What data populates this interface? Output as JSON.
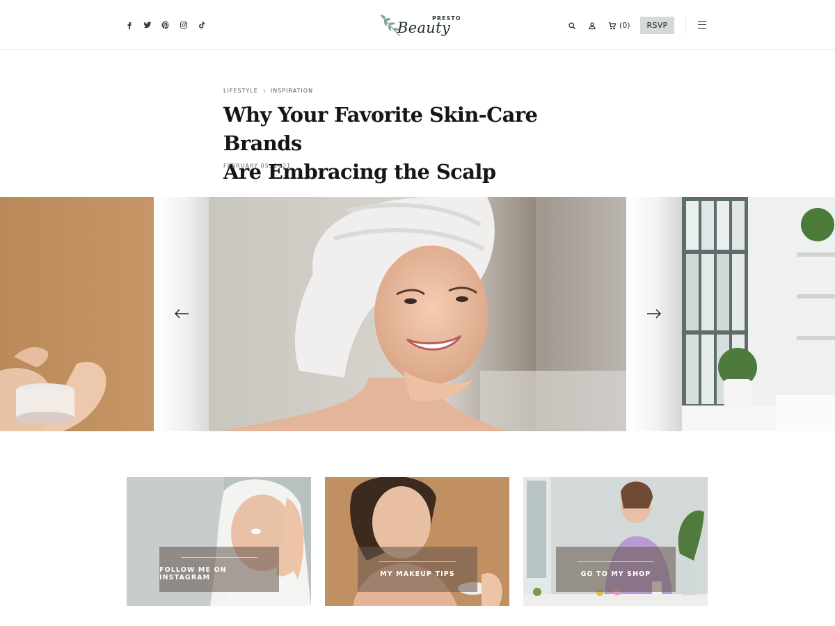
{
  "header": {
    "social_icons": [
      "facebook-icon",
      "twitter-icon",
      "pinterest-icon",
      "instagram-icon",
      "tiktok-icon"
    ],
    "logo": {
      "small_text": "PRESTO",
      "main_text": "Beauty"
    },
    "cart_count": "(0)",
    "rsvp_label": "RSVP"
  },
  "article": {
    "categories": [
      "LIFESTYLE",
      "INSPIRATION"
    ],
    "title_line1": "Why Your Favorite Skin-Care Brands",
    "title_line2": "Are Embracing the Scalp",
    "date": "FEBRUARY 05, 2021"
  },
  "cards": [
    {
      "label": "FOLLOW ME ON INSTAGRAM"
    },
    {
      "label": "MY MAKEUP TIPS"
    },
    {
      "label": "GO TO MY SHOP"
    }
  ],
  "colors": {
    "accent_button": "#d4dad9",
    "text_dark": "#151515",
    "overlay": "#64554b"
  }
}
